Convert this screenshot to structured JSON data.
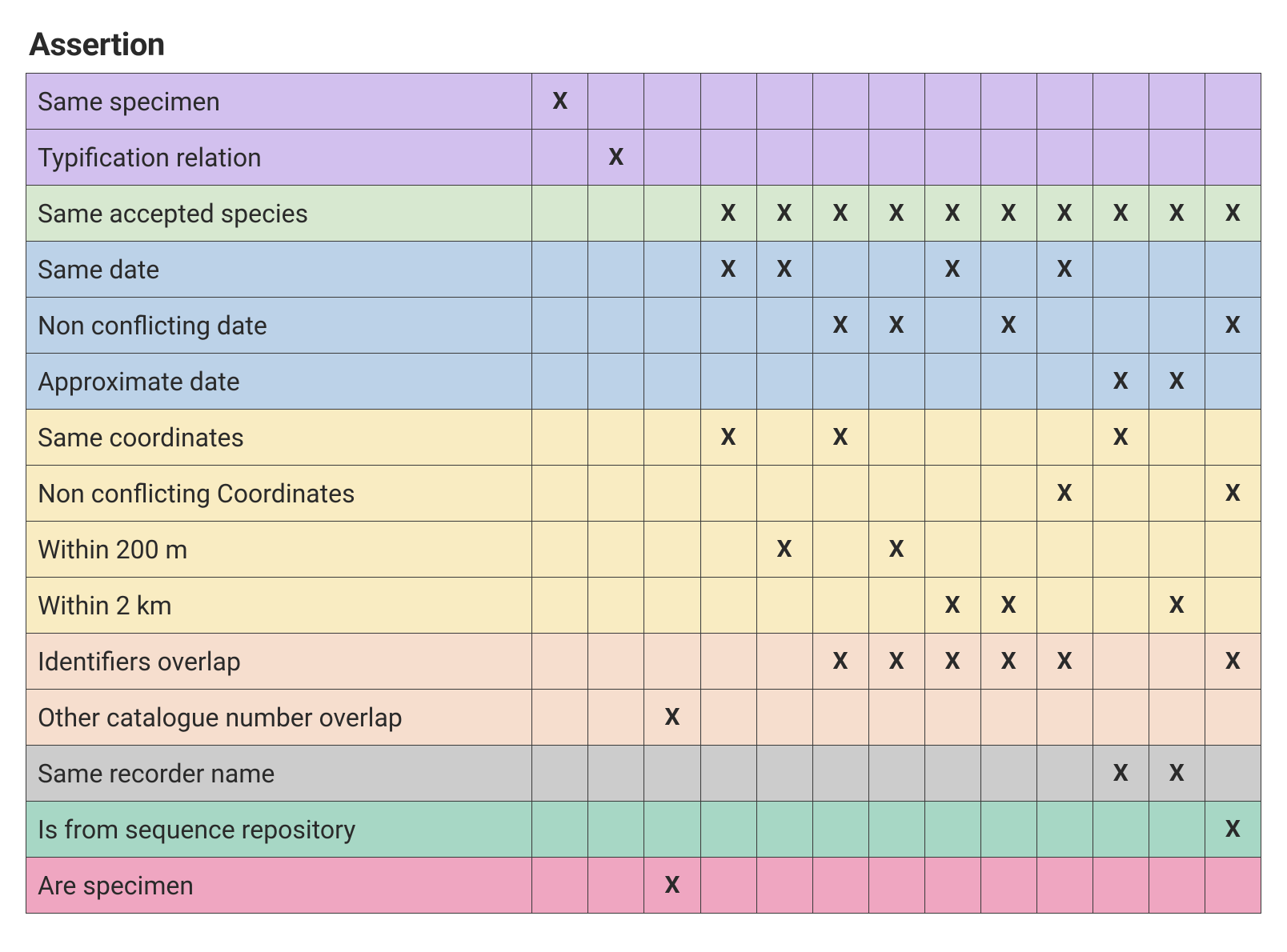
{
  "title": "Assertion",
  "mark": "X",
  "columns": 13,
  "rows": [
    {
      "label": "Same specimen",
      "color": "purple",
      "marks": [
        1,
        0,
        0,
        0,
        0,
        0,
        0,
        0,
        0,
        0,
        0,
        0,
        0
      ]
    },
    {
      "label": "Typification relation",
      "color": "purple",
      "marks": [
        0,
        1,
        0,
        0,
        0,
        0,
        0,
        0,
        0,
        0,
        0,
        0,
        0
      ]
    },
    {
      "label": "Same accepted species",
      "color": "green",
      "marks": [
        0,
        0,
        0,
        1,
        1,
        1,
        1,
        1,
        1,
        1,
        1,
        1,
        1
      ]
    },
    {
      "label": "Same date",
      "color": "blue",
      "marks": [
        0,
        0,
        0,
        1,
        1,
        0,
        0,
        1,
        0,
        1,
        0,
        0,
        0
      ]
    },
    {
      "label": "Non conflicting date",
      "color": "blue",
      "marks": [
        0,
        0,
        0,
        0,
        0,
        1,
        1,
        0,
        1,
        0,
        0,
        0,
        1
      ]
    },
    {
      "label": "Approximate date",
      "color": "blue",
      "marks": [
        0,
        0,
        0,
        0,
        0,
        0,
        0,
        0,
        0,
        0,
        1,
        1,
        0
      ]
    },
    {
      "label": "Same coordinates",
      "color": "yellow",
      "marks": [
        0,
        0,
        0,
        1,
        0,
        1,
        0,
        0,
        0,
        0,
        1,
        0,
        0
      ]
    },
    {
      "label": "Non conflicting Coordinates",
      "color": "yellow",
      "marks": [
        0,
        0,
        0,
        0,
        0,
        0,
        0,
        0,
        0,
        1,
        0,
        0,
        1
      ]
    },
    {
      "label": "Within 200 m",
      "color": "yellow",
      "marks": [
        0,
        0,
        0,
        0,
        1,
        0,
        1,
        0,
        0,
        0,
        0,
        0,
        0
      ]
    },
    {
      "label": "Within 2 km",
      "color": "yellow",
      "marks": [
        0,
        0,
        0,
        0,
        0,
        0,
        0,
        1,
        1,
        0,
        0,
        1,
        0
      ]
    },
    {
      "label": "Identifiers overlap",
      "color": "orange",
      "marks": [
        0,
        0,
        0,
        0,
        0,
        1,
        1,
        1,
        1,
        1,
        0,
        0,
        1
      ]
    },
    {
      "label": "Other catalogue number overlap",
      "color": "orange",
      "marks": [
        0,
        0,
        1,
        0,
        0,
        0,
        0,
        0,
        0,
        0,
        0,
        0,
        0
      ]
    },
    {
      "label": "Same recorder name",
      "color": "grey",
      "marks": [
        0,
        0,
        0,
        0,
        0,
        0,
        0,
        0,
        0,
        0,
        1,
        1,
        0
      ]
    },
    {
      "label": "Is from sequence repository",
      "color": "teal",
      "marks": [
        0,
        0,
        0,
        0,
        0,
        0,
        0,
        0,
        0,
        0,
        0,
        0,
        1
      ]
    },
    {
      "label": "Are specimen",
      "color": "pink",
      "marks": [
        0,
        0,
        1,
        0,
        0,
        0,
        0,
        0,
        0,
        0,
        0,
        0,
        0
      ]
    }
  ]
}
